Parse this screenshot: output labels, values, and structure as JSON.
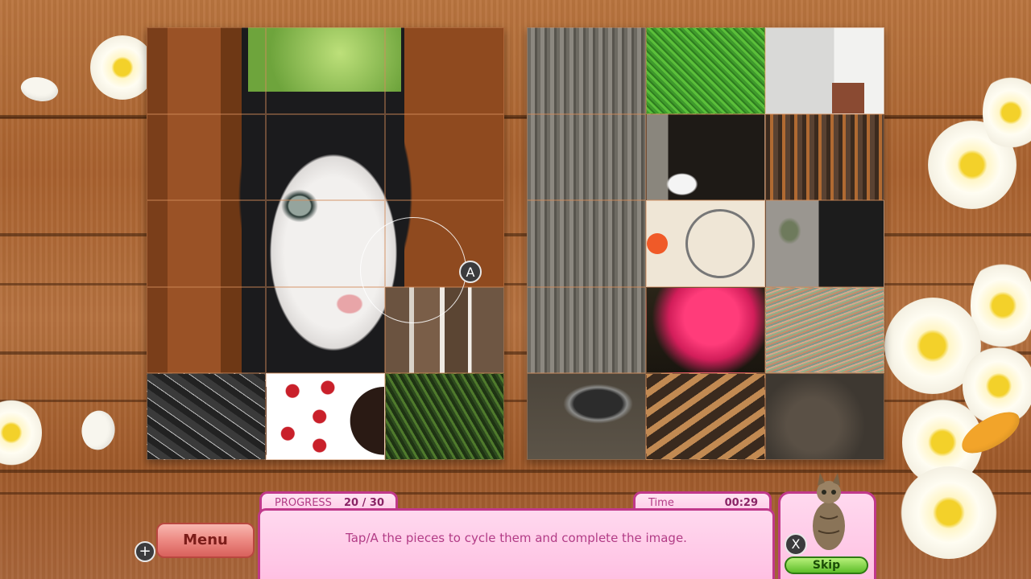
{
  "hud": {
    "progress_label": "PROGRESS",
    "progress_value": "20 / 30",
    "progress_fraction": 0.667,
    "time_label": "Time",
    "time_value": "00:29",
    "hint": "Tap/A the pieces to cycle them and complete the image.",
    "menu_label": "Menu",
    "skip_label": "Skip",
    "plus_glyph": "+",
    "a_glyph": "A",
    "x_glyph": "X"
  },
  "colors": {
    "accent_pink": "#c0398a",
    "panel_pink": "#ffc0e2",
    "menu_red": "#ee8d86",
    "skip_green": "#5dbd2a",
    "wood": "#a8612f"
  },
  "left_puzzle": {
    "tiles": [
      {
        "id": "L1",
        "content": "fence-wood",
        "solved": true
      },
      {
        "id": "L2",
        "content": "cat-ear-green",
        "solved": true
      },
      {
        "id": "L3",
        "content": "fence-wood",
        "solved": true
      },
      {
        "id": "L4",
        "content": "fence-wood",
        "solved": true
      },
      {
        "id": "L5",
        "content": "cat-eye",
        "solved": true
      },
      {
        "id": "L6",
        "content": "fence-wood",
        "solved": true
      },
      {
        "id": "L7",
        "content": "fence-wood",
        "solved": true
      },
      {
        "id": "L8",
        "content": "cat-cheek",
        "solved": true
      },
      {
        "id": "L9",
        "content": "fence-wood",
        "solved": true
      },
      {
        "id": "L10",
        "content": "fence-wood",
        "solved": true
      },
      {
        "id": "L11",
        "content": "cat-nose",
        "solved": true
      },
      {
        "id": "L12",
        "content": "icicles",
        "solved": false
      },
      {
        "id": "L13",
        "content": "broken-glass",
        "solved": false
      },
      {
        "id": "L14",
        "content": "red-berries",
        "solved": false
      },
      {
        "id": "L15",
        "content": "pine-beads",
        "solved": false
      }
    ]
  },
  "right_puzzle": {
    "tiles": [
      {
        "id": "R1",
        "content": "grey-wood",
        "solved": true
      },
      {
        "id": "R2",
        "content": "green-grass",
        "solved": false
      },
      {
        "id": "R3",
        "content": "white-house",
        "solved": false
      },
      {
        "id": "R4",
        "content": "grey-wood",
        "solved": true
      },
      {
        "id": "R5",
        "content": "paw-dark",
        "solved": true
      },
      {
        "id": "R6",
        "content": "broken-wood",
        "solved": true
      },
      {
        "id": "R7",
        "content": "grey-wood",
        "solved": true
      },
      {
        "id": "R8",
        "content": "bicycle",
        "solved": false
      },
      {
        "id": "R9",
        "content": "cat-peek",
        "solved": true
      },
      {
        "id": "R10",
        "content": "grey-wood",
        "solved": true
      },
      {
        "id": "R11",
        "content": "pink-flower",
        "solved": false
      },
      {
        "id": "R12",
        "content": "thread-spool",
        "solved": false
      },
      {
        "id": "R13",
        "content": "cat-paw-ground",
        "solved": true
      },
      {
        "id": "R14",
        "content": "crochet-hooks",
        "solved": false
      },
      {
        "id": "R15",
        "content": "dirt-ground",
        "solved": true
      }
    ]
  }
}
